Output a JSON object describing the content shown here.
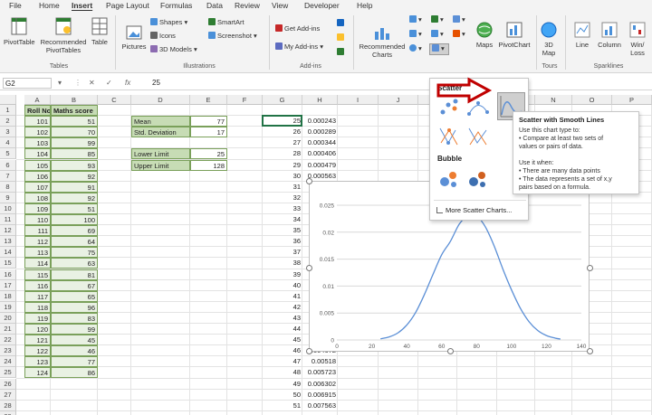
{
  "tabs": [
    "File",
    "Home",
    "Insert",
    "Page Layout",
    "Formulas",
    "Data",
    "Review",
    "View",
    "Developer",
    "Help"
  ],
  "ribbon": {
    "pivot_table": "PivotTable",
    "recommended_pivot": [
      "Recommended",
      "PivotTables"
    ],
    "table": "Table",
    "tables_group": "Tables",
    "pictures": "Pictures",
    "shapes": "Shapes",
    "icons": "Icons",
    "models": "3D Models",
    "smartart": "SmartArt",
    "screenshot": "Screenshot",
    "illustrations_group": "Illustrations",
    "get_addins": "Get Add-ins",
    "my_addins": "My Add-ins",
    "addins_group": "Add-ins",
    "recommended_charts": [
      "Recommended",
      "Charts"
    ],
    "maps": "Maps",
    "pivot_chart": "PivotChart",
    "map3d": [
      "3D",
      "Map"
    ],
    "tours_group": "Tours",
    "line": "Line",
    "column": "Column",
    "winloss": [
      "Win/",
      "Loss"
    ],
    "sparklines_group": "Sparklines"
  },
  "formula_bar": {
    "name_box": "G2",
    "fx": "fx",
    "value": "25"
  },
  "columns": [
    "A",
    "B",
    "C",
    "D",
    "E",
    "F",
    "G",
    "H",
    "I",
    "J",
    "K",
    "L",
    "M",
    "N",
    "O",
    "P"
  ],
  "rows": [
    "1",
    "2",
    "3",
    "4",
    "5",
    "6",
    "7",
    "8",
    "9",
    "10",
    "11",
    "12",
    "13",
    "14",
    "15",
    "16",
    "17",
    "18",
    "19",
    "20",
    "21",
    "22",
    "23",
    "24",
    "25",
    "26",
    "27",
    "28",
    "29",
    "30"
  ],
  "table": {
    "headers": [
      "Roll No.",
      "Maths score"
    ],
    "rows": [
      [
        "101",
        "51"
      ],
      [
        "102",
        "70"
      ],
      [
        "103",
        "99"
      ],
      [
        "104",
        "85"
      ],
      [
        "105",
        "93"
      ],
      [
        "106",
        "92"
      ],
      [
        "107",
        "91"
      ],
      [
        "108",
        "92"
      ],
      [
        "109",
        "51"
      ],
      [
        "110",
        "100"
      ],
      [
        "111",
        "69"
      ],
      [
        "112",
        "64"
      ],
      [
        "113",
        "75"
      ],
      [
        "114",
        "63"
      ],
      [
        "115",
        "81"
      ],
      [
        "116",
        "67"
      ],
      [
        "117",
        "65"
      ],
      [
        "118",
        "96"
      ],
      [
        "119",
        "83"
      ],
      [
        "120",
        "99"
      ],
      [
        "121",
        "45"
      ],
      [
        "122",
        "46"
      ],
      [
        "123",
        "77"
      ],
      [
        "124",
        "86"
      ]
    ]
  },
  "stats": [
    {
      "label": "Mean",
      "value": "77"
    },
    {
      "label": "Std. Deviation",
      "value": "17"
    }
  ],
  "limits": [
    {
      "label": "Lower Limit",
      "value": "25"
    },
    {
      "label": "Upper Limit",
      "value": "128"
    }
  ],
  "g_column": [
    "25",
    "26",
    "27",
    "28",
    "29",
    "30",
    "31",
    "32",
    "33",
    "34",
    "35",
    "36",
    "37",
    "38",
    "39",
    "40",
    "41",
    "42",
    "43",
    "44",
    "45",
    "46",
    "47",
    "48",
    "49",
    "50",
    "51"
  ],
  "h_column": [
    "0.000243",
    "0.000289",
    "0.000344",
    "0.000406",
    "0.000479",
    "0.000563",
    "",
    "",
    "",
    "",
    "",
    "",
    "",
    "",
    "",
    "",
    "",
    "",
    "",
    "",
    "",
    "0.004672",
    "0.00518",
    "0.005723",
    "0.006302",
    "0.006915",
    "0.007563"
  ],
  "dropdown": {
    "scatter_title": "Scatter",
    "bubble_title": "Bubble",
    "more": "More Scatter Charts..."
  },
  "tooltip": {
    "title": "Scatter with Smooth Lines",
    "lines": [
      "Use this chart type to:",
      "• Compare at least two sets of",
      "  values or pairs of data.",
      "",
      "Use it when:",
      "• There are many data points",
      "• The data represents a set of x,y",
      "  pairs based on a formula."
    ]
  },
  "chart_data": {
    "type": "line",
    "title": "",
    "xlabel": "",
    "ylabel": "",
    "xlim": [
      0,
      140
    ],
    "ylim": [
      0,
      0.025
    ],
    "xticks": [
      0,
      20,
      40,
      60,
      80,
      100,
      120,
      140
    ],
    "yticks": [
      0,
      0.005,
      0.01,
      0.015,
      0.02,
      0.025
    ],
    "ytick_labels": [
      "0",
      "0.005",
      "0.01",
      "0.015",
      "0.02",
      "0.025"
    ],
    "gridlines": true,
    "series": [
      {
        "x": [
          25,
          30,
          35,
          40,
          45,
          50,
          55,
          60,
          65,
          70,
          75,
          77,
          80,
          85,
          90,
          95,
          100,
          105,
          110,
          115,
          120,
          125,
          128
        ],
        "y": [
          0.00022,
          0.00057,
          0.00132,
          0.00276,
          0.00505,
          0.00834,
          0.01214,
          0.0158,
          0.0183,
          0.02145,
          0.02324,
          0.02347,
          0.02312,
          0.021,
          0.0175,
          0.0132,
          0.0093,
          0.00592,
          0.0034,
          0.00176,
          0.00082,
          0.00034,
          0.00018
        ]
      }
    ],
    "color": "#5b8fd6"
  }
}
